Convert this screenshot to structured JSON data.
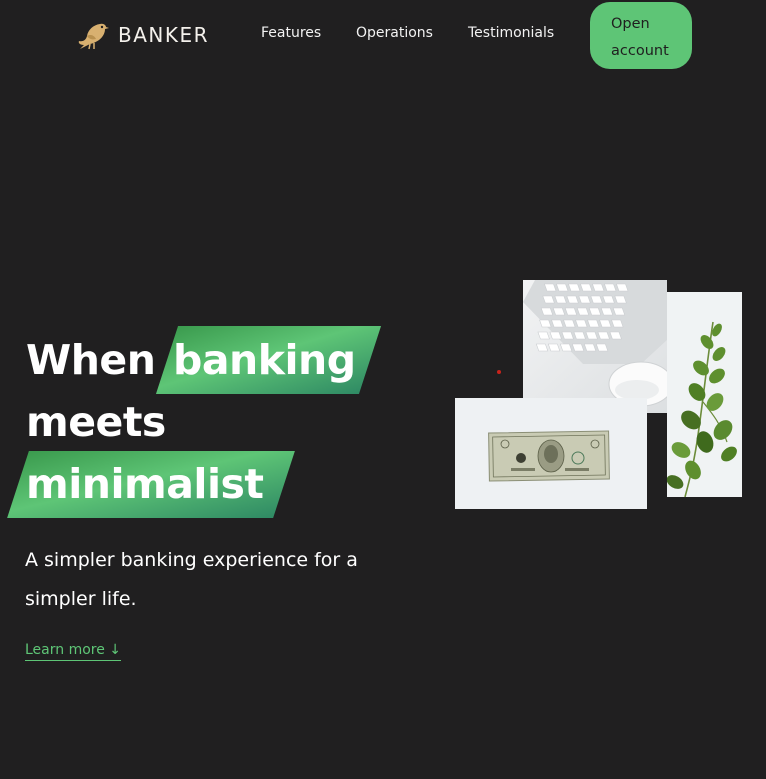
{
  "brand": {
    "name": "BANKER",
    "icon": "bird-logo-icon"
  },
  "nav": {
    "links": [
      "Features",
      "Operations",
      "Testimonials"
    ],
    "cta": {
      "line1": "Open",
      "line2": "account"
    }
  },
  "hero": {
    "title": {
      "word1": "When",
      "word2": "banking",
      "word3": "meets",
      "word4": "minimalist"
    },
    "subtitle": "A simpler banking experience for a simpler life.",
    "learn_more": "Learn more ↓"
  },
  "images": [
    "keyboard-mouse-image",
    "plant-image",
    "dollar-bill-image"
  ],
  "colors": {
    "background": "#201f20",
    "accent": "#5ec576",
    "text": "#ffffff"
  }
}
